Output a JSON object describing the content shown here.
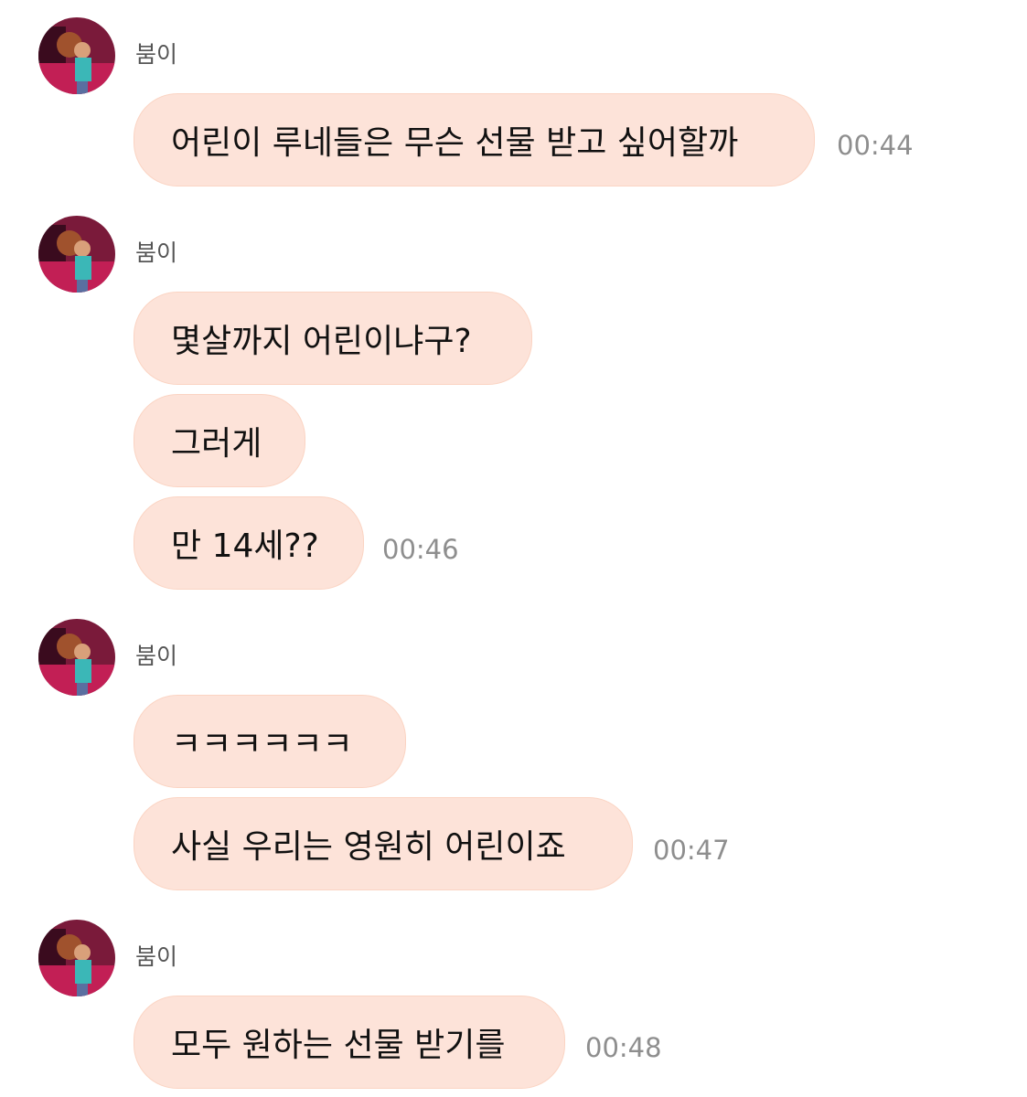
{
  "sender": "붐이",
  "groups": [
    {
      "sender": "붐이",
      "messages": [
        {
          "text": "어린이 루네들은 무슨 선물 받고 싶어할까",
          "time": "00:44"
        }
      ]
    },
    {
      "sender": "붐이",
      "messages": [
        {
          "text": "몇살까지 어린이냐구?"
        },
        {
          "text": "그러게"
        },
        {
          "text": "만 14세??",
          "time": "00:46"
        }
      ]
    },
    {
      "sender": "붐이",
      "messages": [
        {
          "text": "ㅋㅋㅋㅋㅋㅋ"
        },
        {
          "text": "사실 우리는 영원히 어린이죠",
          "time": "00:47"
        }
      ]
    },
    {
      "sender": "붐이",
      "messages": [
        {
          "text": "모두 원하는 선물 받기를",
          "time": "00:48"
        }
      ]
    }
  ],
  "colors": {
    "bubble": "#fde3d9",
    "bubble_border": "#fbd4c3",
    "time": "#8e8e8e",
    "sender": "#555555"
  },
  "icons": {
    "avatar": "profile-photo-icon"
  }
}
